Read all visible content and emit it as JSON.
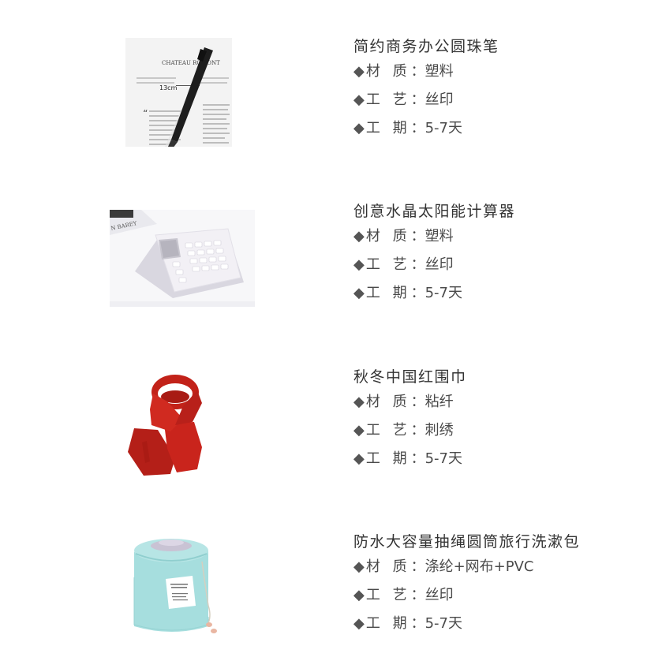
{
  "products": [
    {
      "title": "简约商务办公圆珠笔",
      "specs": [
        {
          "bullet": "◆",
          "label": "材 质",
          "sep": "：",
          "value": "塑料"
        },
        {
          "bullet": "◆",
          "label": "工 艺",
          "sep": "：",
          "value": "丝印"
        },
        {
          "bullet": "◆",
          "label": "工 期",
          "sep": "：",
          "value": "5-7天"
        }
      ],
      "image_text": {
        "heading": "CHATEAU ROMONT",
        "ruler": "13cm"
      }
    },
    {
      "title": "创意水晶太阳能计算器",
      "specs": [
        {
          "bullet": "◆",
          "label": "材 质",
          "sep": "：",
          "value": "塑料"
        },
        {
          "bullet": "◆",
          "label": "工 艺",
          "sep": "：",
          "value": "丝印"
        },
        {
          "bullet": "◆",
          "label": "工 期",
          "sep": "：",
          "value": "5-7天"
        }
      ],
      "image_text": {
        "book": "N BAREY"
      }
    },
    {
      "title": "秋冬中国红围巾",
      "specs": [
        {
          "bullet": "◆",
          "label": "材 质",
          "sep": "：",
          "value": "粘纤"
        },
        {
          "bullet": "◆",
          "label": "工 艺",
          "sep": "：",
          "value": "刺绣"
        },
        {
          "bullet": "◆",
          "label": "工 期",
          "sep": "：",
          "value": "5-7天"
        }
      ]
    },
    {
      "title": "防水大容量抽绳圆筒旅行洗漱包",
      "specs": [
        {
          "bullet": "◆",
          "label": "材 质",
          "sep": "：",
          "value": "涤纶+网布+PVC"
        },
        {
          "bullet": "◆",
          "label": "工 艺",
          "sep": "：",
          "value": "丝印"
        },
        {
          "bullet": "◆",
          "label": "工 期",
          "sep": "：",
          "value": "5-7天"
        }
      ]
    }
  ],
  "colors": {
    "scarf_red": "#c9241c",
    "bag_mint": "#a6dede",
    "calculator_white": "#f2f0f5",
    "pen_black": "#1e1e1e"
  }
}
